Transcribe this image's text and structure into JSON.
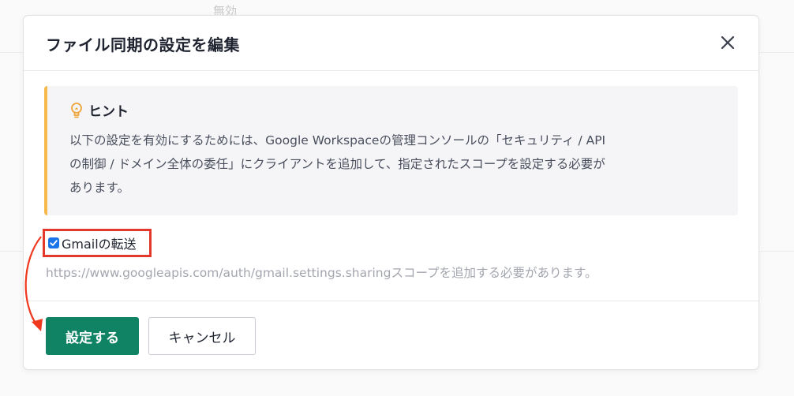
{
  "background": {
    "text": "無効"
  },
  "dialog": {
    "title": "ファイル同期の設定を編集",
    "close_icon": "close-icon"
  },
  "hint": {
    "icon": "lightbulb-icon",
    "title": "ヒント",
    "lines": [
      "以下の設定を有効にするためには、Google Workspaceの管理コンソールの「セキュリティ / API",
      "の制御 / ドメイン全体の委任」にクライアントを追加して、指定されたスコープを設定する必要が",
      "あります。"
    ],
    "accent_color": "#f6b94a"
  },
  "gmail_forwarding": {
    "label": "Gmailの転送",
    "checked": true,
    "helper": "https://www.googleapis.com/auth/gmail.settings.sharingスコープを追加する必要があります。"
  },
  "footer": {
    "submit_label": "設定する",
    "cancel_label": "キャンセル",
    "submit_color": "#0f8364"
  },
  "annotation": {
    "highlight_color": "#e4382b"
  }
}
